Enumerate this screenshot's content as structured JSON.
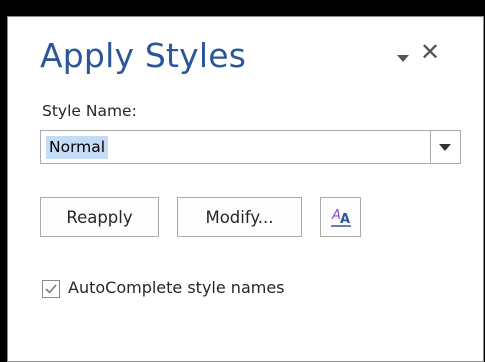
{
  "pane": {
    "title": "Apply Styles",
    "dropdown_icon": "chevron-down-icon",
    "close_glyph": "✕"
  },
  "style_name": {
    "label": "Style Name:",
    "value": "Normal",
    "dropdown_icon": "dropdown-arrow-icon"
  },
  "buttons": {
    "reapply": "Reapply",
    "modify": "Modify...",
    "manage_styles_icon": "manage-styles-icon"
  },
  "autocomplete": {
    "label": "AutoComplete style names",
    "checked": true
  },
  "colors": {
    "title": "#2b579a",
    "selection": "#c5dcf7",
    "border": "#ababab",
    "frame": "#000000"
  }
}
